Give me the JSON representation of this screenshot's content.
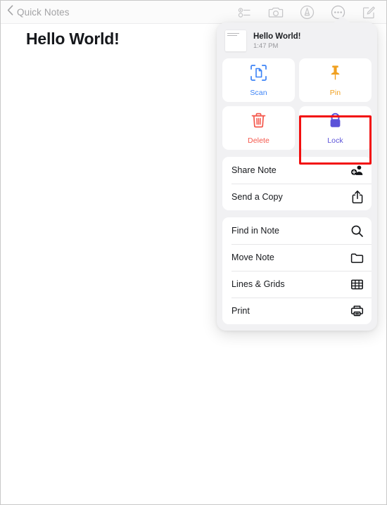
{
  "window": {
    "app": "Notes"
  },
  "toolbar": {
    "back_label": "Quick Notes",
    "back_icon": "chevron-left-icon",
    "icons": [
      {
        "name": "checklist-icon",
        "label": "Checklist"
      },
      {
        "name": "camera-icon",
        "label": "Camera"
      },
      {
        "name": "markup-pen-icon",
        "label": "Markup"
      },
      {
        "name": "ellipsis-circle-icon",
        "label": "More"
      },
      {
        "name": "compose-icon",
        "label": "Compose"
      }
    ]
  },
  "note": {
    "title": "Hello World!"
  },
  "popover": {
    "header": {
      "title": "Hello World!",
      "time": "1:47 PM",
      "thumbnail_name": "note-thumbnail"
    },
    "actions": [
      {
        "key": "scan",
        "label": "Scan",
        "icon": "document-scan-icon",
        "color": "#3b82f6"
      },
      {
        "key": "pin",
        "label": "Pin",
        "icon": "pin-icon",
        "color": "#f0a020"
      },
      {
        "key": "delete",
        "label": "Delete",
        "icon": "trash-icon",
        "color": "#f4564a"
      },
      {
        "key": "lock",
        "label": "Lock",
        "icon": "lock-icon",
        "color": "#5b52d8"
      }
    ],
    "groups": [
      {
        "items": [
          {
            "label": "Share Note",
            "icon": "share-people-icon"
          },
          {
            "label": "Send a Copy",
            "icon": "share-up-arrow-icon"
          }
        ]
      },
      {
        "items": [
          {
            "label": "Find in Note",
            "icon": "magnifier-icon"
          },
          {
            "label": "Move Note",
            "icon": "folder-icon"
          },
          {
            "label": "Lines & Grids",
            "icon": "grid-icon"
          },
          {
            "label": "Print",
            "icon": "printer-icon"
          }
        ]
      }
    ]
  },
  "annotation": {
    "highlight_target": "Lock",
    "highlight_color": "#f20f0f"
  }
}
